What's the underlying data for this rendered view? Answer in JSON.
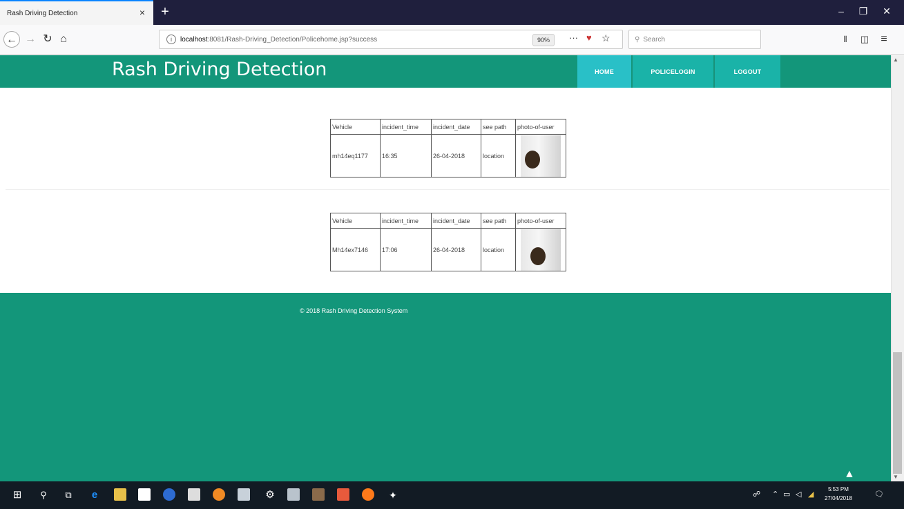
{
  "browser": {
    "tab_title": "Rash Driving Detection",
    "tab_close": "×",
    "new_tab": "+",
    "url_host": "localhost",
    "url_path": ":8081/Rash-Driving_Detection/Policehome.jsp?success",
    "zoom": "90%",
    "search_placeholder": "Search"
  },
  "header": {
    "title": "Rash Driving Detection",
    "menu": [
      "HOME",
      "POLICELOGIN",
      "LOGOUT"
    ]
  },
  "records": [
    {
      "columns": [
        "Vehicle",
        "incident_time",
        "incident_date",
        "see path",
        "photo-of-user"
      ],
      "vehicle": "mh14eq1177",
      "time": "16:35",
      "date": "26-04-2018",
      "path_link": "location"
    },
    {
      "columns": [
        "Vehicle",
        "incident_time",
        "incident_date",
        "see path",
        "photo-of-user"
      ],
      "vehicle": "Mh14ex7146",
      "time": "17:06",
      "date": "26-04-2018",
      "path_link": "location"
    }
  ],
  "footer": {
    "copyright": "© 2018 Rash Driving Detection System"
  },
  "taskbar": {
    "time": "5:53 PM",
    "date": "27/04/2018"
  }
}
